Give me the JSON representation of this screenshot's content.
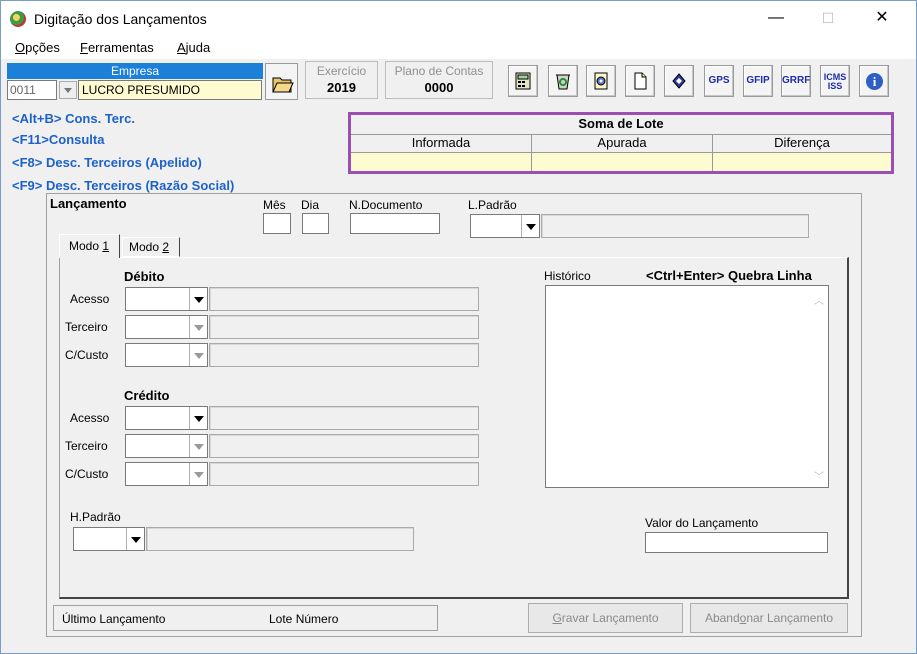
{
  "window": {
    "title": "Digitação dos Lançamentos",
    "min": "—",
    "max": "☐",
    "close": "✕"
  },
  "menu": [
    {
      "label": "Opções",
      "accel": "O",
      "rest": "pções"
    },
    {
      "label": "Ferramentas",
      "accel": "F",
      "rest": "erramentas"
    },
    {
      "label": "Ajuda",
      "accel": "A",
      "rest": "juda"
    }
  ],
  "empresa": {
    "header": "Empresa",
    "code": "0011",
    "name": "LUCRO PRESUMIDO"
  },
  "exercicio": {
    "label": "Exercício",
    "value": "2019"
  },
  "plano": {
    "label": "Plano de Contas",
    "value": "0000"
  },
  "toolbar": {
    "gps": "GPS",
    "gfip": "GFIP",
    "grrf": "GRRF",
    "icms1": "ICMS",
    "icms2": "ISS",
    "info": "i"
  },
  "shortcuts": [
    "<Alt+B> Cons. Terc.",
    "<F11>Consulta",
    "<F8> Desc. Terceiros (Apelido)",
    "<F9> Desc. Terceiros (Razão Social)"
  ],
  "soma": {
    "title": "Soma de Lote",
    "cols": [
      "Informada",
      "Apurada",
      "Diferença"
    ]
  },
  "lancamento": {
    "title": "Lançamento",
    "mes": "Mês",
    "dia": "Dia",
    "ndoc": "N.Documento",
    "lpadrao": "L.Padrão",
    "tab1_a": "Modo ",
    "tab1_b": "1",
    "tab2_a": "Modo ",
    "tab2_b": "2",
    "debito": "Débito",
    "credito": "Crédito",
    "acesso": "Acesso",
    "terceiro": "Terceiro",
    "ccusto": "C/Custo",
    "historico": "Histórico",
    "quebra": "<Ctrl+Enter> Quebra Linha",
    "hpadrao": "H.Padrão",
    "valor": "Valor do Lançamento",
    "ultimo": "Último Lançamento",
    "lote": "Lote Número",
    "gravar_a": "",
    "gravar_u": "G",
    "gravar_b": "ravar Lançamento",
    "aband_a": "Aband",
    "aband_u": "o",
    "aband_b": "nar Lançamento"
  }
}
